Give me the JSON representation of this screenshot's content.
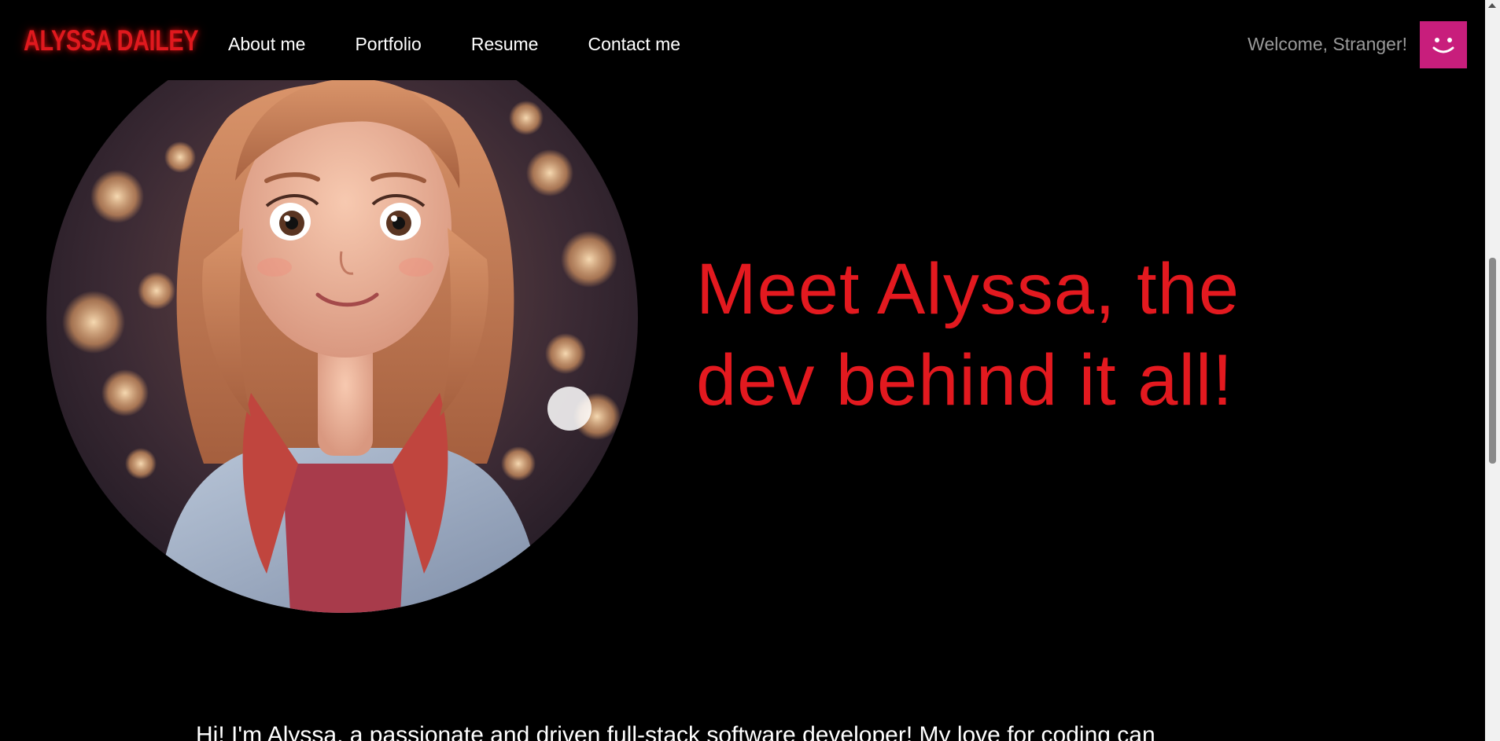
{
  "header": {
    "logo": "ALYSSA DAILEY",
    "nav": [
      "About me",
      "Portfolio",
      "Resume",
      "Contact me"
    ],
    "welcome": "Welcome, Stranger!",
    "avatar_icon": "smiley-face-icon",
    "avatar_color": "#c81e7c"
  },
  "hero": {
    "image_icon": "cartoon-girl-portrait",
    "headline_line1": "Meet Alyssa, the",
    "headline_line2": "dev behind it all!",
    "headline_color": "#e3191f"
  },
  "intro": {
    "text": "Hi! I'm Alyssa, a passionate and driven full-stack software developer! My love for coding can"
  },
  "colors": {
    "background": "#000000",
    "accent": "#e0191e"
  }
}
